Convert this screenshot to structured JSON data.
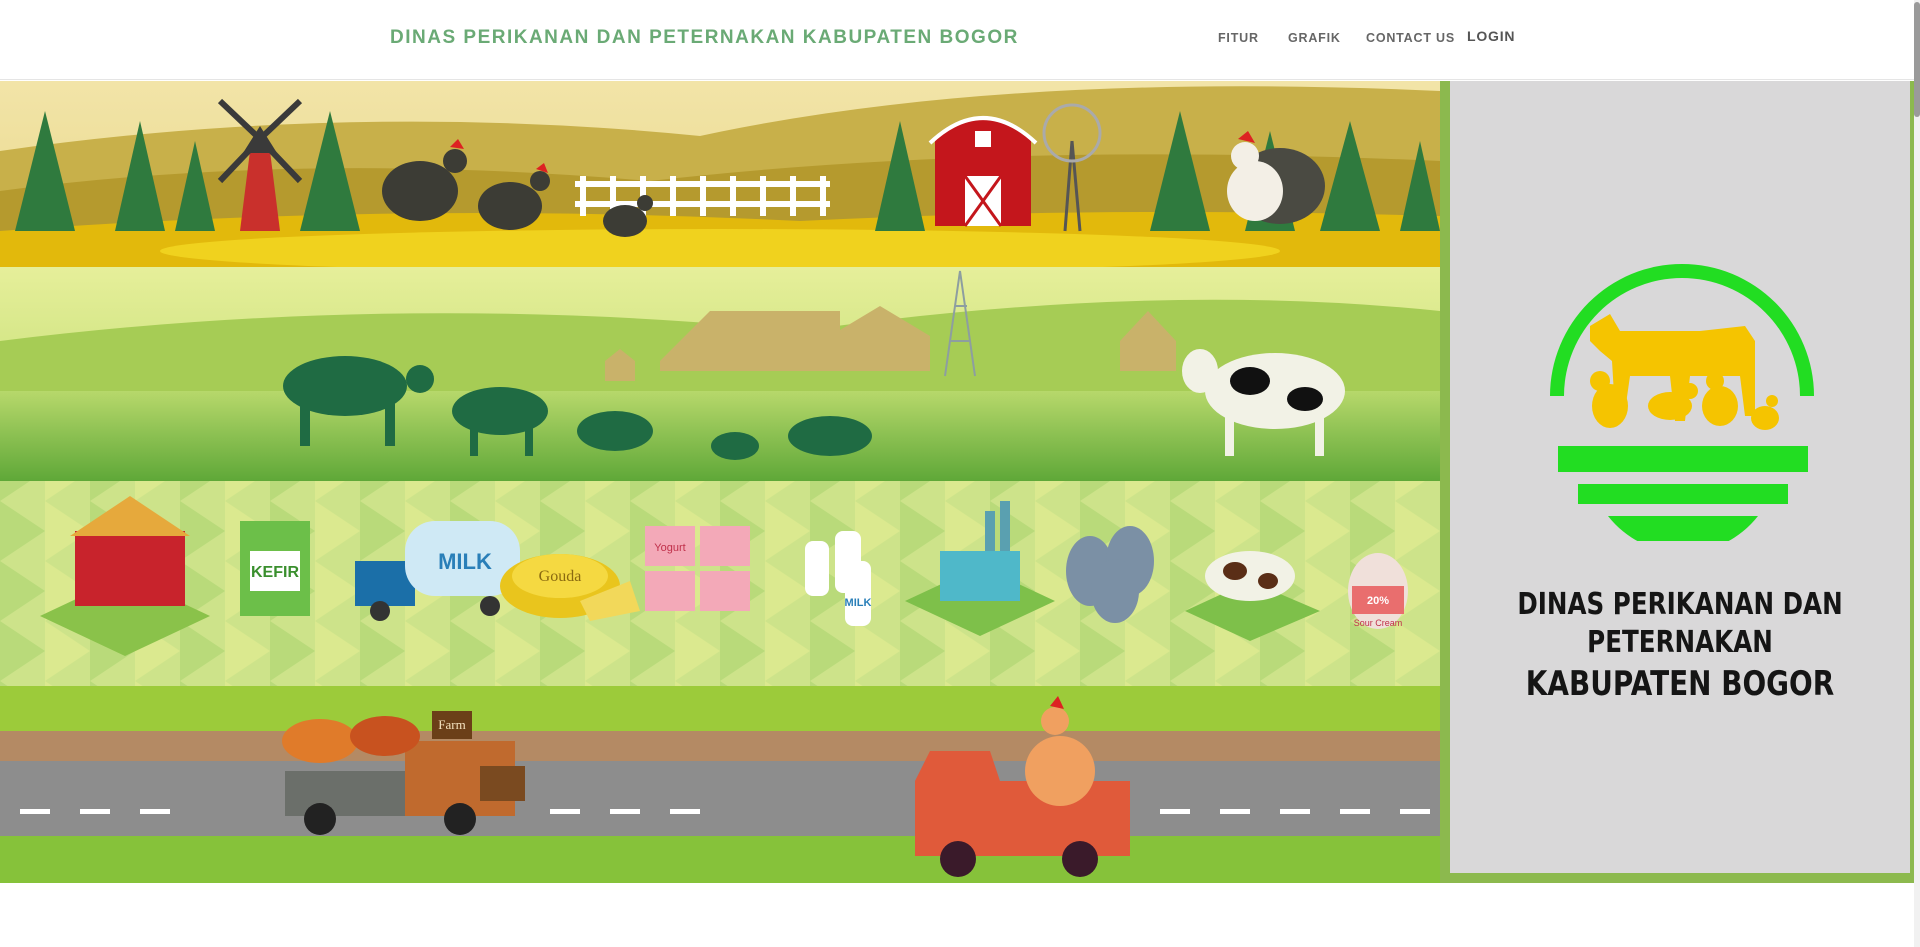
{
  "navbar": {
    "brand": "DINAS PERIKANAN DAN PETERNAKAN KABUPATEN BOGOR",
    "links": [
      {
        "label": "FITUR"
      },
      {
        "label": "GRAFIK"
      },
      {
        "label": "CONTACT US"
      }
    ],
    "login": "LOGIN"
  },
  "hero": {
    "products": [
      "KEFIR",
      "MILK",
      "Gouda",
      "Yogurt",
      "MILK",
      "Sour Cream"
    ],
    "farm_sign": "Farm",
    "sour_cream_pct": "20%"
  },
  "sidebar": {
    "title_line1": "DINAS PERIKANAN DAN PETERNAKAN",
    "title_line2": "KABUPATEN BOGOR"
  },
  "colors": {
    "brand_green": "#6aaa75",
    "sidebar_border": "#8cb94e",
    "sidebar_bg": "#d9d8d9",
    "logo_green": "#22dd22",
    "logo_yellow": "#f5c400"
  },
  "icons": [
    "windmill-icon",
    "barn-icon",
    "rooster-icon",
    "cow-icon",
    "truck-icon",
    "logo-emblem-icon"
  ]
}
